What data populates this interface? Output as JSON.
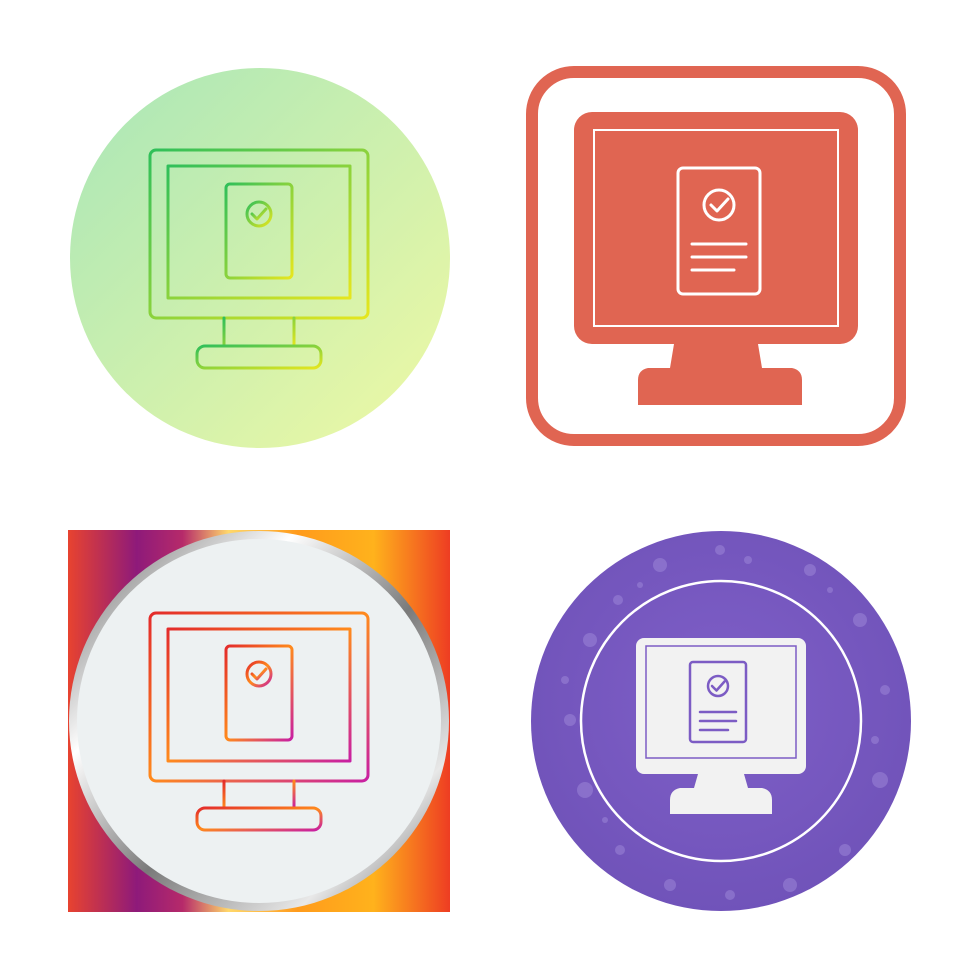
{
  "icon_set": {
    "subject": "monitor-with-approved-document-icon",
    "variants": [
      {
        "style": "gradient-line-on-gradient-circle",
        "background_gradient": [
          "#a8e6b8",
          "#f0f9a4"
        ],
        "stroke_gradient": [
          "#2fbf5a",
          "#e6e61e"
        ]
      },
      {
        "style": "flat-glyph-in-rounded-square-frame",
        "color": "#e06552",
        "detail_color": "#ffffff"
      },
      {
        "style": "gradient-line-on-metallic-circle-over-gradient-square",
        "background_gradient": [
          "#e8432f",
          "#8e1a7a",
          "#ffd86b",
          "#ff9b1c",
          "#ee3d22"
        ],
        "ring_color": "#9a9a9a",
        "inner_fill": "#edf1f2",
        "stroke_gradient": [
          "#e32b2b",
          "#ff8a1c",
          "#c81fa2"
        ]
      },
      {
        "style": "flat-glyph-on-grunge-circle",
        "color": "#7c5cc4",
        "glyph_fill": "#f2f2f2",
        "ring_color": "#ffffff"
      }
    ]
  }
}
